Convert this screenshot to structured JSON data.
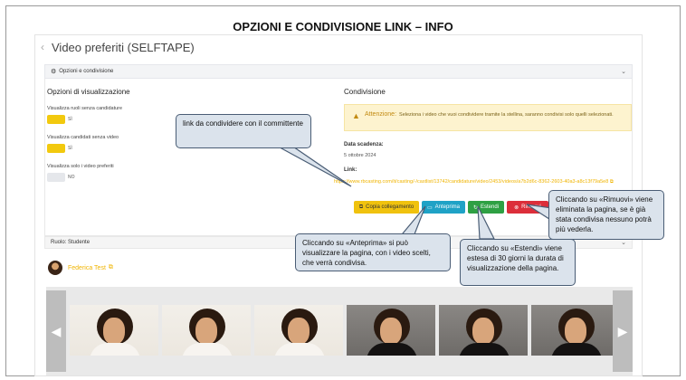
{
  "slide": {
    "title": "OPZIONI E CONDIVISIONE LINK – INFO"
  },
  "page": {
    "back_icon": "chevron-left-icon",
    "title": "Video preferiti (SELFTAPE)"
  },
  "section": {
    "label": "Opzioni e condivisione",
    "icon": "gear-icon",
    "chevron": "chevron-down-icon"
  },
  "display_options": {
    "title": "Opzioni di visualizzazione",
    "items": [
      {
        "label": "Visualizza ruoli senza candidature",
        "state": "SÌ",
        "on": true
      },
      {
        "label": "Visualizza candidati senza video",
        "state": "SÌ",
        "on": true
      },
      {
        "label": "Visualizza solo i video preferiti",
        "state": "NO",
        "on": false
      }
    ]
  },
  "sharing": {
    "title": "Condivisione",
    "warning_label": "Attenzione:",
    "warning_text": "Seleziona i video che vuoi condividere tramite la stellina, saranno condivisi solo quelli selezionati.",
    "expiry_label": "Data scadenza:",
    "expiry_value": "5 ottobre 2024",
    "link_label": "Link:",
    "link_value": "https://www.rbcasting.com/it/casting/-/castlist/13742/candidature/video/2453/videos/a7b2d6c-8362-2603-40a3-a8c13f79a5e8",
    "buttons": {
      "copy": "Copia collegamento",
      "preview": "Anteprima",
      "extend": "Estendi",
      "remove": "Rimuovi"
    }
  },
  "role": {
    "label": "Ruolo: Studente"
  },
  "candidate": {
    "name": "Federica Test"
  },
  "callouts": {
    "link": "link da condividere con il committente",
    "preview": "Cliccando su «Anteprima» si può visualizzare la pagina, con i video scelti, che verrà condivisa.",
    "extend": "Cliccando su «Estendi» viene estesa di 30 giorni la durata di visualizzazione della pagina.",
    "remove": "Cliccando su «Rimuovi» viene eliminata la pagina, se è già stata condivisa nessuno potrà più vederla."
  },
  "colors": {
    "accent_yellow": "#f0c20e",
    "preview_blue": "#1fa2c6",
    "extend_green": "#2ea043",
    "remove_red": "#dc2e3a",
    "callout_fill": "#dbe3ec",
    "callout_border": "#4a5d75"
  }
}
